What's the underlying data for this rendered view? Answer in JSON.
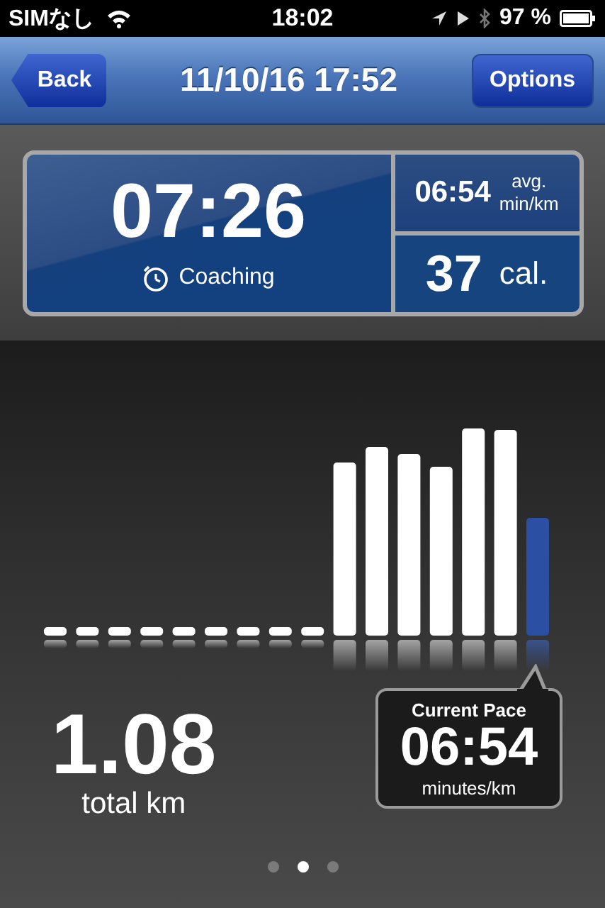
{
  "status_bar": {
    "carrier": "SIMなし",
    "time": "18:02",
    "battery": "97 %"
  },
  "nav_bar": {
    "back": "Back",
    "title": "11/10/16 17:52",
    "options": "Options"
  },
  "dashboard": {
    "duration": "07:26",
    "coaching": "Coaching",
    "avg_pace": "06:54",
    "avg_label": "avg.",
    "avg_unit": "min/km",
    "calories": "37",
    "calories_unit": "cal."
  },
  "distance": {
    "value": "1.08",
    "label": "total km"
  },
  "current_pace": {
    "title": "Current Pace",
    "value": "06:54",
    "unit": "minutes/km"
  },
  "page_dots": [
    {
      "selected": false
    },
    {
      "selected": true
    },
    {
      "selected": false
    }
  ]
}
